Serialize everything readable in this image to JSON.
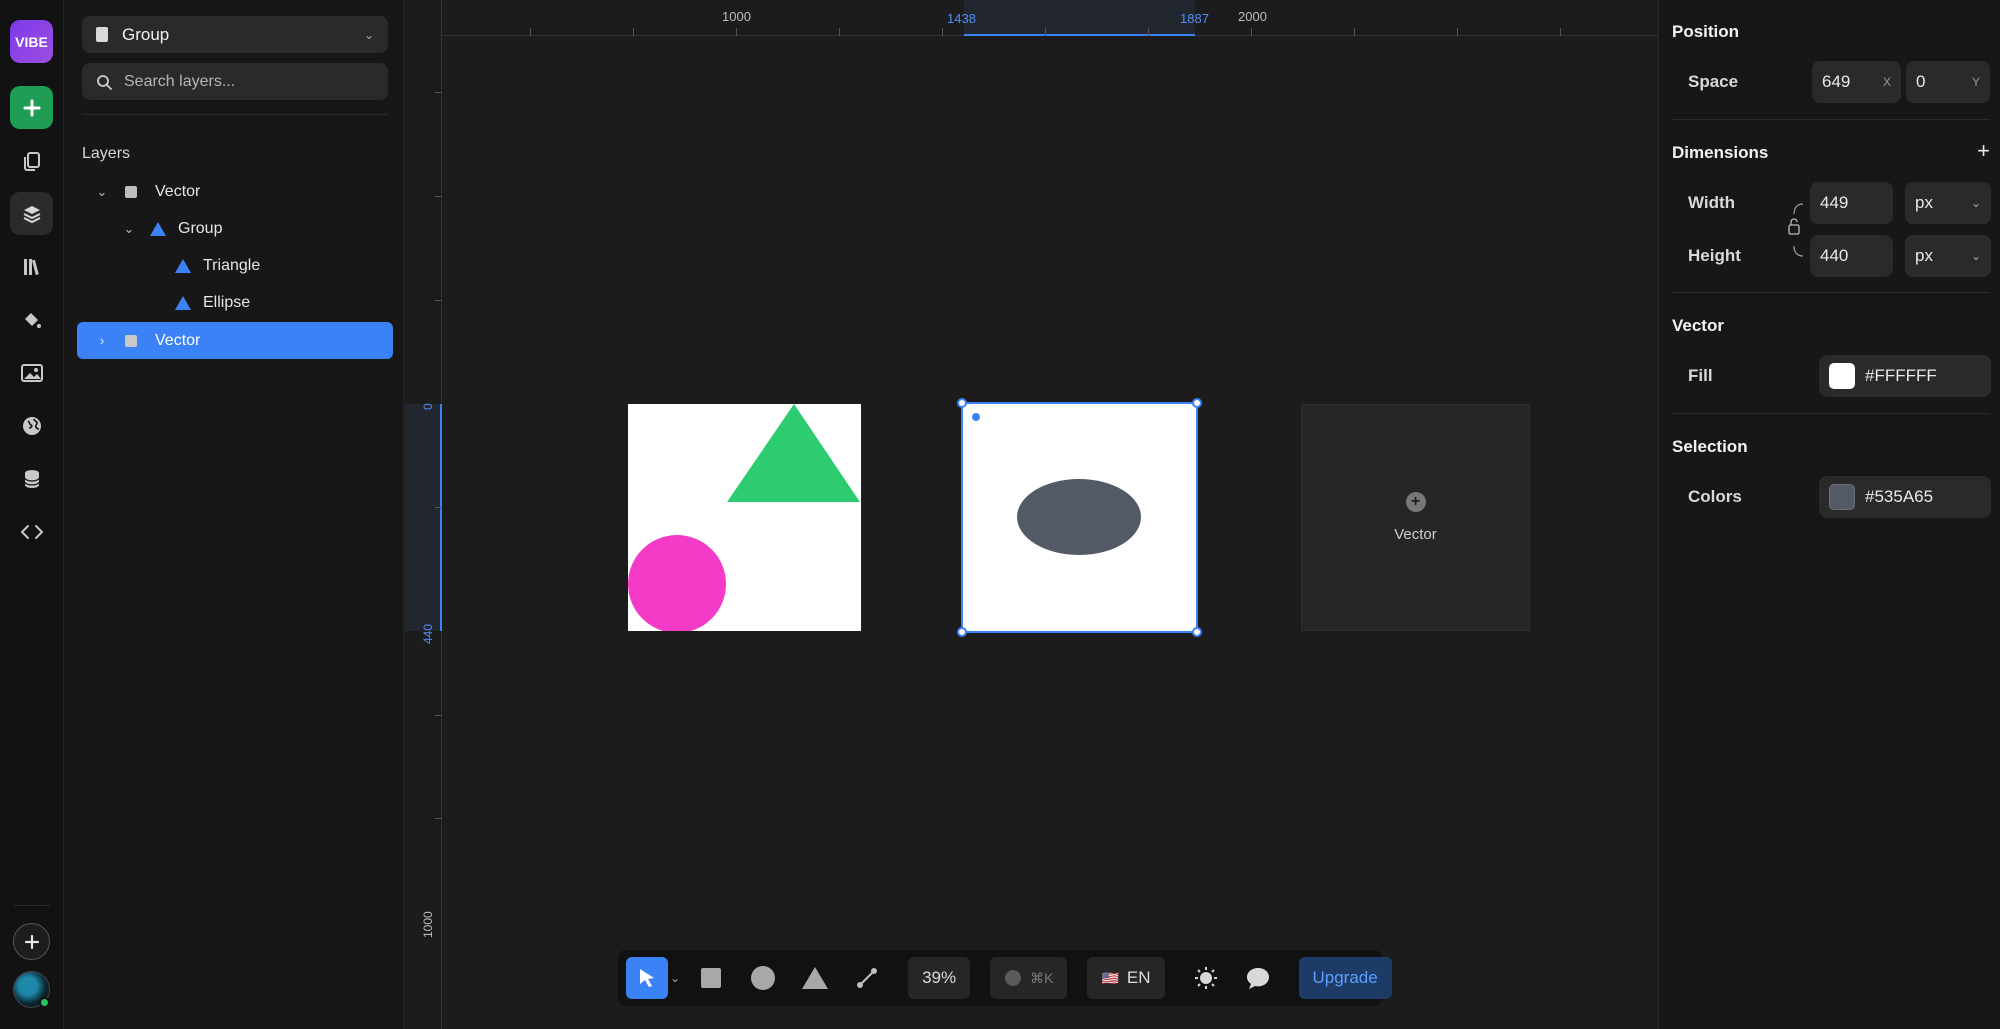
{
  "rail": {
    "logo": "VIBE",
    "icons": [
      "plus-icon",
      "pages-icon",
      "layers-icon",
      "library-icon",
      "paint-bucket-icon",
      "image-icon",
      "globe-icon",
      "database-icon",
      "code-icon"
    ],
    "add_icon": "plus-icon"
  },
  "layers_panel": {
    "group_select": "Group",
    "search_placeholder": "Search layers...",
    "title": "Layers",
    "items": [
      {
        "label": "Vector",
        "expanded": true
      },
      {
        "label": "Group",
        "expanded": true
      },
      {
        "label": "Triangle"
      },
      {
        "label": "Ellipse"
      },
      {
        "label": "Vector",
        "selected": true,
        "expanded": false
      }
    ]
  },
  "canvas": {
    "h_ruler_labels": [
      "1000",
      "1438",
      "1887",
      "2000"
    ],
    "v_ruler_labels": [
      "0",
      "440",
      "1000"
    ],
    "placeholder_label": "Vector",
    "colors": {
      "pink": "#F43BC7",
      "green": "#2ECC71",
      "ellipse": "#535A65",
      "selection": "#3B82F6"
    }
  },
  "toolbar": {
    "zoom": "39%",
    "search_shortcut": "⌘K",
    "language": "EN",
    "flag": "🇺🇸",
    "upgrade": "Upgrade"
  },
  "properties": {
    "position": {
      "title": "Position",
      "label": "Space",
      "x": "649",
      "x_suffix": "X",
      "y": "0",
      "y_suffix": "Y"
    },
    "dimensions": {
      "title": "Dimensions",
      "width_label": "Width",
      "width": "449",
      "width_unit": "px",
      "height_label": "Height",
      "height": "440",
      "height_unit": "px"
    },
    "vector": {
      "title": "Vector",
      "fill_label": "Fill",
      "fill": "#FFFFFF"
    },
    "selection": {
      "title": "Selection",
      "colors_label": "Colors",
      "color": "#535A65"
    }
  }
}
